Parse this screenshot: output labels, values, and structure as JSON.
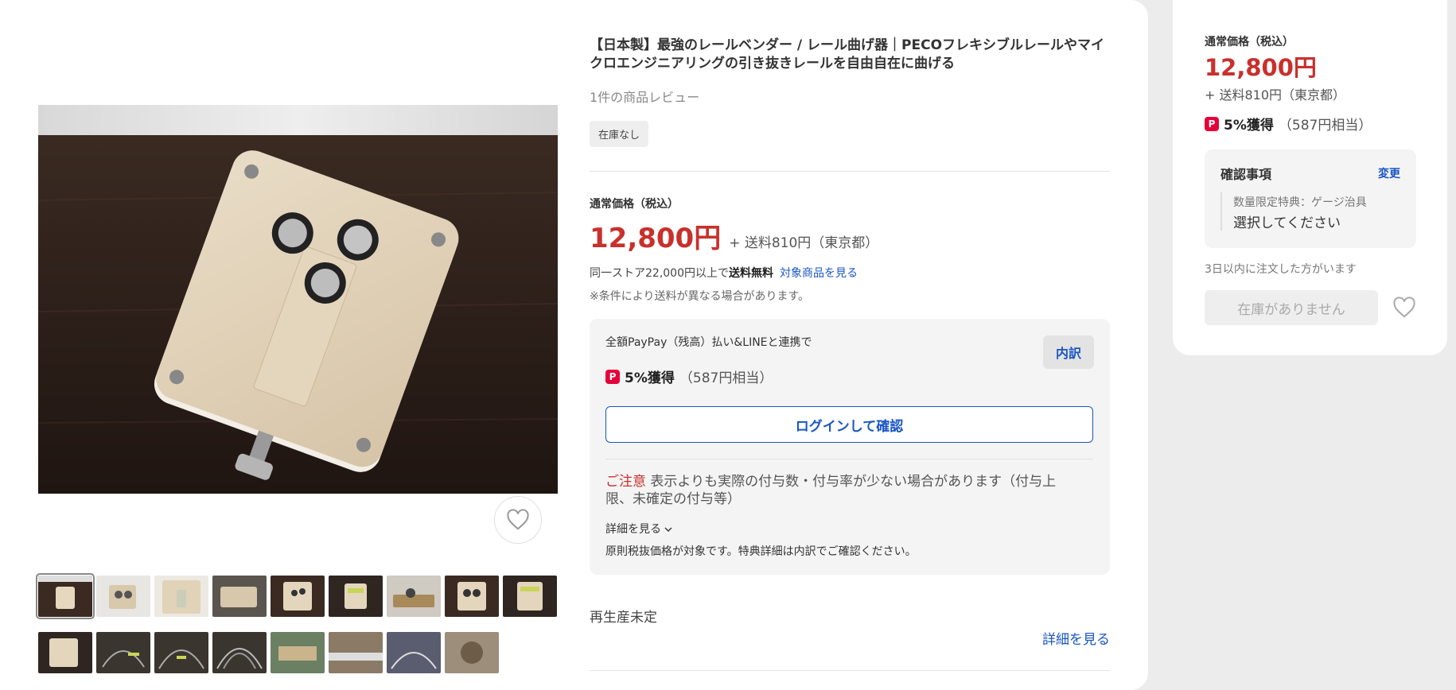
{
  "product": {
    "title": "【日本製】最強のレールベンダー / レール曲げ器｜PECOフレキシブルレールやマイクロエンジニアリングの引き抜きレールを自由自在に曲げる",
    "reviews": "1件の商品レビュー",
    "stock_badge": "在庫なし"
  },
  "price": {
    "label": "通常価格（税込）",
    "amount": "12,800円",
    "shipping": "+ 送料810円（東京都）",
    "free_shipping_prefix": "同一ストア22,000円以上で",
    "free_shipping_bold": "送料無料",
    "free_shipping_link": "対象商品を見る",
    "note": "※条件により送料が異なる場合があります。"
  },
  "paypay": {
    "heading": "全額PayPay（残高）払い&LINEと連携で",
    "breakdown_label": "内訳",
    "rate": "5%獲得",
    "equivalent": "（587円相当）",
    "login_button": "ログインして確認",
    "caution_label": "ご注意",
    "caution_text": "表示よりも実際の付与数・付与率が少ない場合があります（付与上限、未確定の付与等）",
    "details_label": "詳細を見る",
    "footnote": "原則税抜価格が対象です。特典詳細は内訳でご確認ください。",
    "icon_glyph": "P",
    "icon_color": "#e6003a"
  },
  "reproduction": {
    "status": "再生産未定",
    "more_link": "詳細を見る"
  },
  "side": {
    "label": "通常価格（税込）",
    "amount": "12,800円",
    "shipping": "+ 送料810円（東京都）",
    "rate": "5%獲得",
    "equivalent": "（587円相当）",
    "confirm_title": "確認事項",
    "confirm_change": "変更",
    "confirm_sub": "数量限定特典：ゲージ治具",
    "confirm_value": "選択してください",
    "recent_orders": "3日以内に注文した方がいます",
    "out_of_stock_button": "在庫がありません"
  },
  "colors": {
    "price_red": "#c9302c",
    "link_blue": "#1a55c4"
  }
}
